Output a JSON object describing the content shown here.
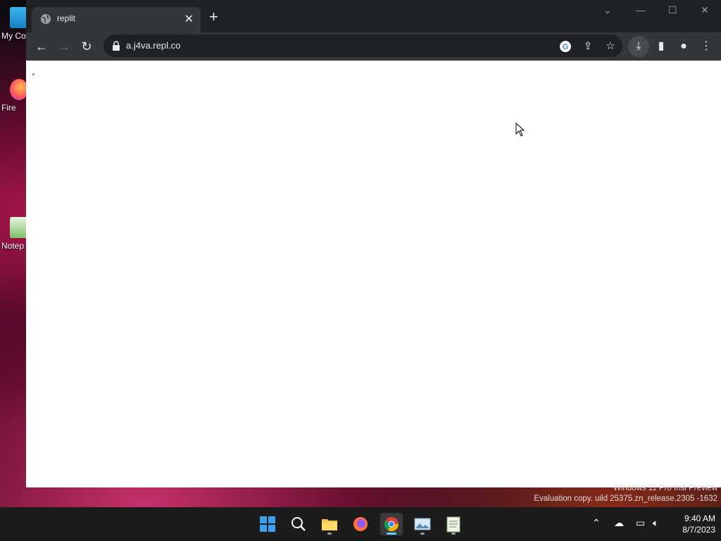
{
  "desktop": {
    "icons": [
      {
        "label": "My Co"
      },
      {
        "label": "Fire"
      },
      {
        "label": "Notep"
      }
    ]
  },
  "browser": {
    "tab": {
      "title": "replit"
    },
    "url": "a.j4va.repl.co"
  },
  "watermark": {
    "line1": "Windows 11 Pro Insi    Preview",
    "line2": "Evaluation copy.   uild 25375.zn_release.2305   -1632"
  },
  "taskbar": {
    "time": "9:40 AM",
    "date": "8/7/2023"
  },
  "colors": {
    "accent": "#60cdff",
    "chrome_dark": "#202124",
    "chrome_toolbar": "#35363a"
  }
}
